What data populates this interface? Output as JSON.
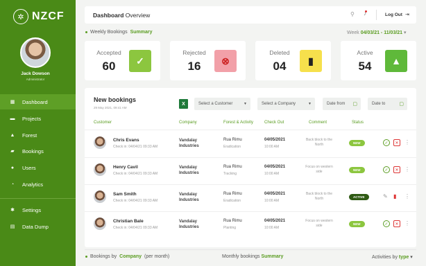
{
  "brand": {
    "name": "NZCF"
  },
  "user": {
    "name": "Jack Dowson",
    "role": "Administrator"
  },
  "nav": {
    "items": [
      {
        "label": "Dashboard",
        "icon": "grid-icon"
      },
      {
        "label": "Projects",
        "icon": "truck-icon"
      },
      {
        "label": "Forest",
        "icon": "tree-icon"
      },
      {
        "label": "Bookings",
        "icon": "ticket-icon"
      },
      {
        "label": "Users",
        "icon": "user-icon"
      },
      {
        "label": "Analytics",
        "icon": "pie-icon"
      }
    ],
    "bottom": [
      {
        "label": "Settings",
        "icon": "gear-icon"
      },
      {
        "label": "Data Dump",
        "icon": "database-icon"
      }
    ]
  },
  "header": {
    "title": "Dashboard",
    "subtitle": "Overview",
    "logout": "Log Out"
  },
  "weekly": {
    "prefix": "Weekly Bookings",
    "emph": "Summary",
    "week_label": "Week",
    "week_range": "04/03/21 - 11/03/21"
  },
  "stats": [
    {
      "label": "Accepted",
      "value": "60",
      "color": "#8cc63f"
    },
    {
      "label": "Rejected",
      "value": "16",
      "color": "#f2a0a8"
    },
    {
      "label": "Deleted",
      "value": "04",
      "color": "#f6e04c"
    },
    {
      "label": "Active",
      "value": "54",
      "color": "#5fb93a"
    }
  ],
  "bookings": {
    "title": "New bookings",
    "date": "29 May 2021, 09:41 AM",
    "filters": {
      "customer": "Select a Customer",
      "company": "Select a Company",
      "date_from": "Date from",
      "date_to": "Date to"
    },
    "columns": [
      "Customer",
      "Company",
      "Forest & Activity",
      "Check Out",
      "Comment",
      "Status"
    ],
    "rows": [
      {
        "name": "Chris Evans",
        "checkin": "Check in: 04/04/21 09:33 AM",
        "company": "Vandalay Industries",
        "forest": "Rua Rimu",
        "activity": "Eradication",
        "out": "04/05/2021",
        "time": "10:00 AM",
        "comment": "Back block to the North",
        "status": "NEW",
        "type": "new"
      },
      {
        "name": "Henry Cavil",
        "checkin": "Check in: 04/04/21 09:33 AM",
        "company": "Vandalay Industries",
        "forest": "Rua Rimu",
        "activity": "Tracking",
        "out": "04/05/2021",
        "time": "10:00 AM",
        "comment": "Focus on western side",
        "status": "NEW",
        "type": "new"
      },
      {
        "name": "Sam Smith",
        "checkin": "Check in: 04/04/21 09:33 AM",
        "company": "Vandalay Industries",
        "forest": "Rua Rimu",
        "activity": "Eradication",
        "out": "04/05/2021",
        "time": "10:00 AM",
        "comment": "Back block to the North",
        "status": "ACTIVE",
        "type": "active"
      },
      {
        "name": "Christian Bale",
        "checkin": "Check in: 04/04/21 09:33 AM",
        "company": "Vandalay Industries",
        "forest": "Rua Rimu",
        "activity": "Planting",
        "out": "04/05/2021",
        "time": "10:00 AM",
        "comment": "Focus on western side",
        "status": "NEW",
        "type": "new"
      }
    ]
  },
  "bottom": {
    "by_company_prefix": "Bookings by",
    "by_company_emph": "Company",
    "by_company_suffix": "(per month)",
    "monthly_prefix": "Monthly bookings",
    "monthly_emph": "Summary",
    "activities_prefix": "Activities by",
    "activities_emph": "type"
  }
}
